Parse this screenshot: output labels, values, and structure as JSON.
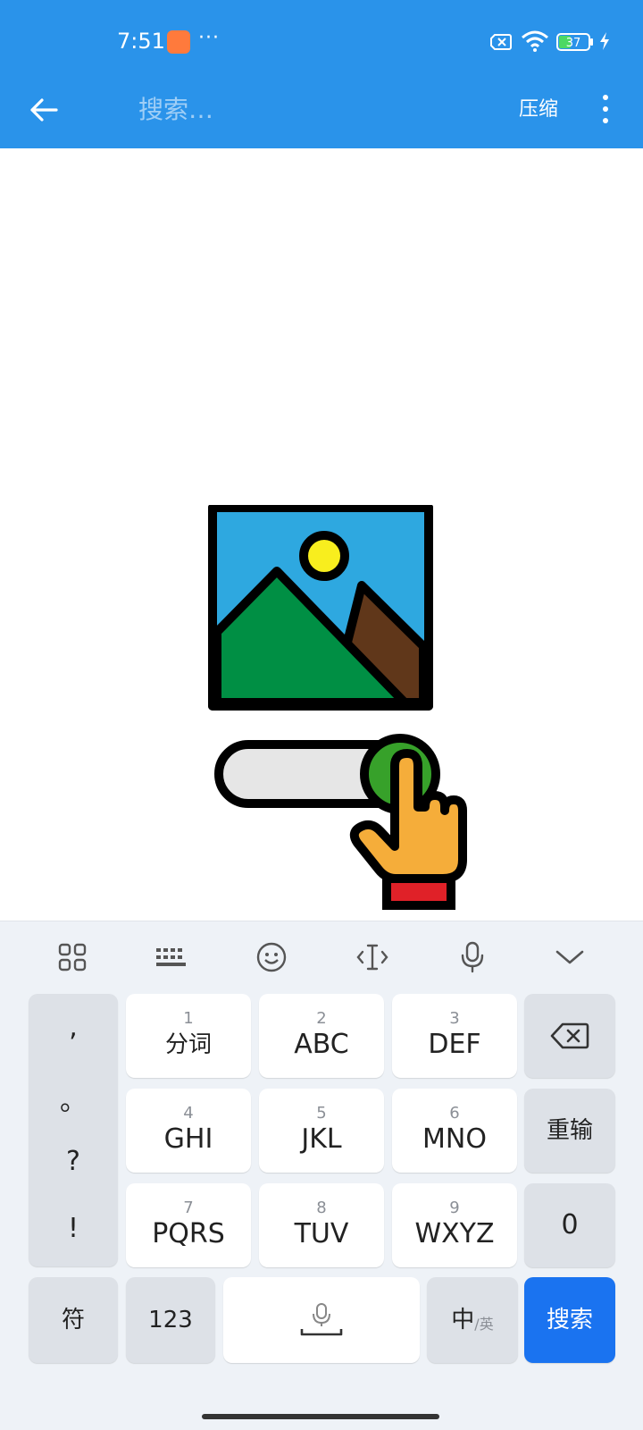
{
  "status_bar": {
    "time": "7:51",
    "more_dots": "···",
    "battery_level": "37",
    "icons": [
      "app-notification-icon",
      "sim-off-icon",
      "wifi-icon",
      "battery-icon",
      "charging-bolt-icon"
    ]
  },
  "app_bar": {
    "search_placeholder": "搜索…",
    "compress_label": "压缩",
    "back_icon": "arrow-left-icon",
    "more_icon": "more-vertical-icon",
    "color": "#2a93ea"
  },
  "keyboard": {
    "toolbar_icons": [
      "grid-menu-icon",
      "keyboard-icon",
      "emoji-icon",
      "cursor-icon",
      "mic-icon",
      "collapse-chevron-icon"
    ],
    "punctuation": [
      ",",
      "。",
      "?",
      "!"
    ],
    "keys": {
      "k1": {
        "num": "1",
        "label": "分词"
      },
      "k2": {
        "num": "2",
        "label": "ABC"
      },
      "k3": {
        "num": "3",
        "label": "DEF"
      },
      "k4": {
        "num": "4",
        "label": "GHI"
      },
      "k5": {
        "num": "5",
        "label": "JKL"
      },
      "k6": {
        "num": "6",
        "label": "MNO"
      },
      "k7": {
        "num": "7",
        "label": "PQRS"
      },
      "k8": {
        "num": "8",
        "label": "TUV"
      },
      "k9": {
        "num": "9",
        "label": "WXYZ"
      }
    },
    "reinput": "重输",
    "zero": "0",
    "symbols": "符",
    "numbers": "123",
    "lang_main": "中",
    "lang_sub": "/英",
    "search_key": "搜索",
    "accent_color": "#1a73f0"
  }
}
